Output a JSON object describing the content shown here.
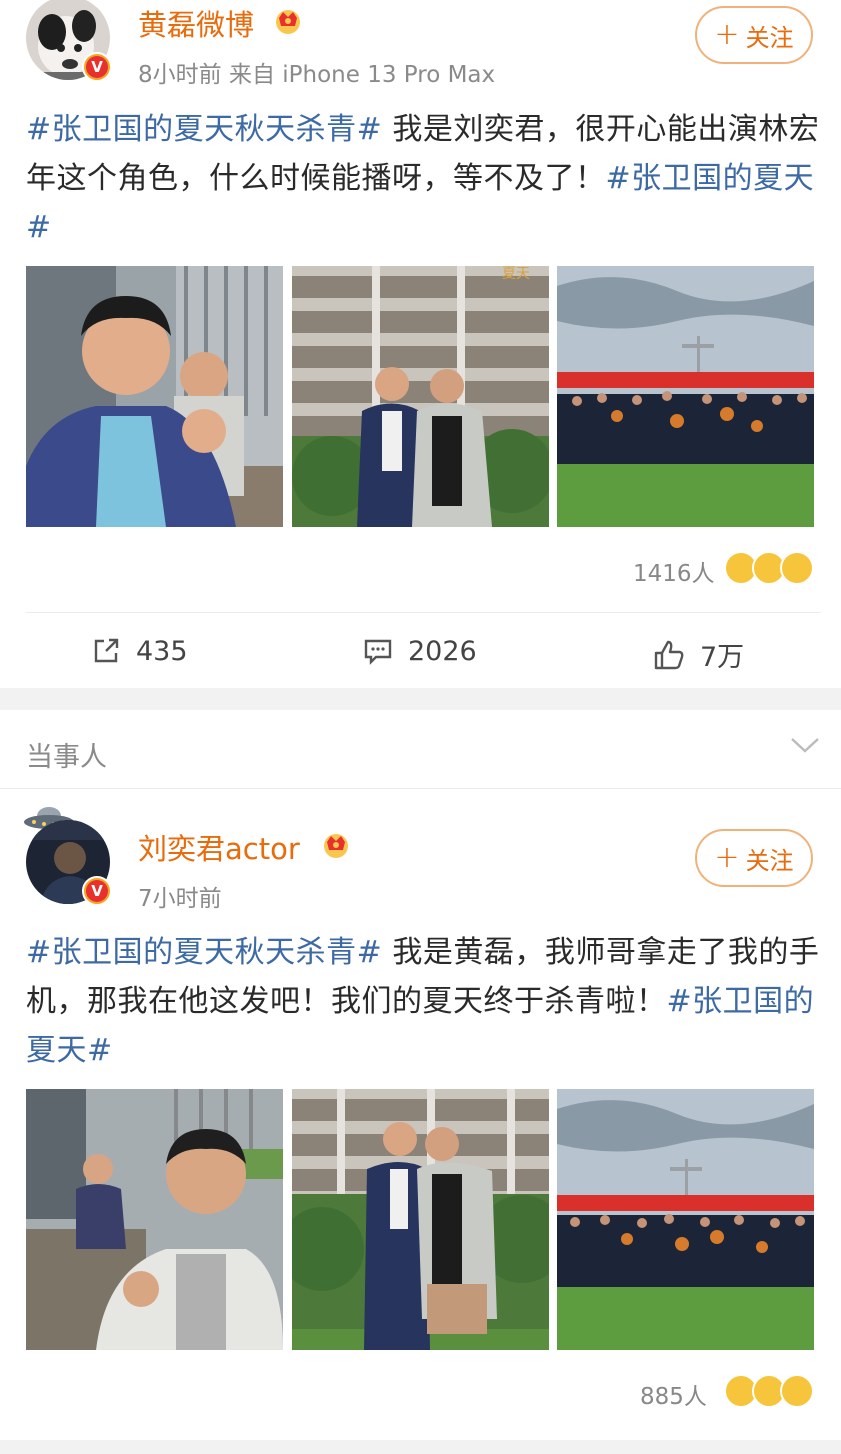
{
  "post1": {
    "name": "黄磊微博",
    "meta": "8小时前  来自 iPhone 13 Pro Max",
    "follow_label": "关注",
    "text_tag1": "#张卫国的夏天秋天杀青#",
    "text_body": " 我是刘奕君，很开心能出演林宏年这个角色，什么时候能播呀，等不及了！",
    "text_tag2": "#张卫国的夏天#",
    "reactions_count": "1416人",
    "repost_count": "435",
    "comment_count": "2026",
    "like_count": "7万"
  },
  "section": {
    "title": "当事人"
  },
  "post2": {
    "name": "刘奕君actor",
    "meta": "7小时前",
    "follow_label": "关注",
    "text_tag1": "#张卫国的夏天秋天杀青#",
    "text_body": " 我是黄磊，我师哥拿走了我的手机，那我在他这发吧！我们的夏天终于杀青啦！",
    "text_tag2": "#张卫国的夏天#",
    "reactions_count": "885人"
  },
  "icons": {
    "repost": "share-icon",
    "comment": "comment-icon",
    "like": "thumbs-up-icon",
    "verified": "verified-v-badge",
    "crown": "crown-icon",
    "chevron": "chevron-down-icon"
  },
  "colors": {
    "name": "#e86b0c",
    "tag": "#3d6aa5",
    "badge": "#e8302d"
  }
}
